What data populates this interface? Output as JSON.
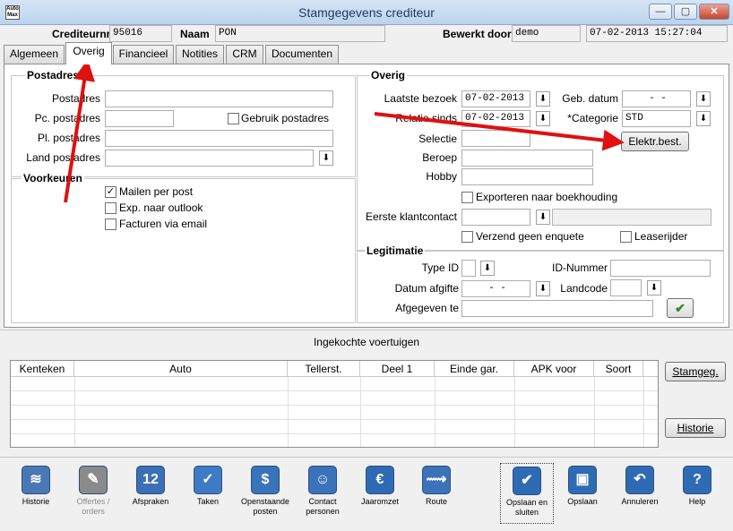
{
  "window": {
    "title": "Stamgegevens crediteur",
    "app_icon_text": "Auto\nMax",
    "min": "—",
    "max": "▢",
    "close": "✕"
  },
  "header": {
    "crediteurnr_label": "Crediteurnr.",
    "crediteurnr_value": "95016",
    "naam_label": "Naam",
    "naam_value": "PON",
    "bewerkt_door_label": "Bewerkt door",
    "bewerkt_door_value": "demo",
    "timestamp": "07-02-2013 15:27:04"
  },
  "tabs": [
    "Algemeen",
    "Overig",
    "Financieel",
    "Notities",
    "CRM",
    "Documenten"
  ],
  "postadres": {
    "title": "Postadres",
    "postadres_label": "Postadres",
    "pc_label": "Pc. postadres",
    "pl_label": "Pl. postadres",
    "land_label": "Land postadres",
    "gebruik_label": "Gebruik postadres"
  },
  "voorkeuren": {
    "title": "Voorkeuren",
    "mailen": "Mailen per post",
    "exp": "Exp. naar outlook",
    "facturen": "Facturen via email"
  },
  "overig": {
    "title": "Overig",
    "laatste_bezoek_label": "Laatste bezoek",
    "laatste_bezoek_value": "07-02-2013",
    "geb_datum_label": "Geb. datum",
    "geb_datum_value": "-  -",
    "relatie_sinds_label": "Relatie sinds",
    "relatie_sinds_value": "07-02-2013",
    "categorie_label": "*Categorie",
    "categorie_value": "STD",
    "selectie_label": "Selectie",
    "elektr_button": "Elektr.best.",
    "beroep_label": "Beroep",
    "hobby_label": "Hobby",
    "exporteren_label": "Exporteren naar boekhouding",
    "eerste_klantcontact_label": "Eerste klantcontact",
    "verzend_label": "Verzend geen enquete",
    "leaserijder_label": "Leaserijder"
  },
  "legitimatie": {
    "title": "Legitimatie",
    "type_id_label": "Type ID",
    "id_nummer_label": "ID-Nummer",
    "datum_afgifte_label": "Datum afgifte",
    "datum_afgifte_value": "-  -",
    "landcode_label": "Landcode",
    "afgegeven_label": "Afgegeven te"
  },
  "vehicles": {
    "title": "Ingekochte voertuigen",
    "columns": [
      "Kenteken",
      "Auto",
      "Tellerst.",
      "Deel 1",
      "Einde gar.",
      "APK voor",
      "Soort"
    ],
    "stamgeg_button": "Stamgeg.",
    "historie_button": "Historie"
  },
  "toolbar": [
    {
      "label": "Historie",
      "icon": "scroll-icon",
      "color": "#4a78b5",
      "glyph": "≋"
    },
    {
      "label": "Offertes / orders",
      "icon": "document-pen-icon",
      "color": "#8a8a8a",
      "glyph": "✎"
    },
    {
      "label": "Afspraken",
      "icon": "calendar-icon",
      "color": "#3b6fb6",
      "glyph": "12"
    },
    {
      "label": "Taken",
      "icon": "checklist-icon",
      "color": "#3d7bc4",
      "glyph": "✓"
    },
    {
      "label": "Openstaande posten",
      "icon": "money-icon",
      "color": "#3a73b9",
      "glyph": "$"
    },
    {
      "label": "Contact personen",
      "icon": "people-icon",
      "color": "#3a73b9",
      "glyph": "☺"
    },
    {
      "label": "Jaaromzet",
      "icon": "euro-coin-icon",
      "color": "#2f6bb5",
      "glyph": "€"
    },
    {
      "label": "Route",
      "icon": "road-icon",
      "color": "#3a73b9",
      "glyph": "⟿"
    },
    {
      "label": "Opslaan en sluiten",
      "icon": "check-icon",
      "color": "#2f6bb5",
      "glyph": "✔"
    },
    {
      "label": "Opslaan",
      "icon": "floppy-icon",
      "color": "#2f6bb5",
      "glyph": "▣"
    },
    {
      "label": "Annuleren",
      "icon": "undo-icon",
      "color": "#2f6bb5",
      "glyph": "↶"
    },
    {
      "label": "Help",
      "icon": "help-icon",
      "color": "#2f6bb5",
      "glyph": "?"
    }
  ]
}
